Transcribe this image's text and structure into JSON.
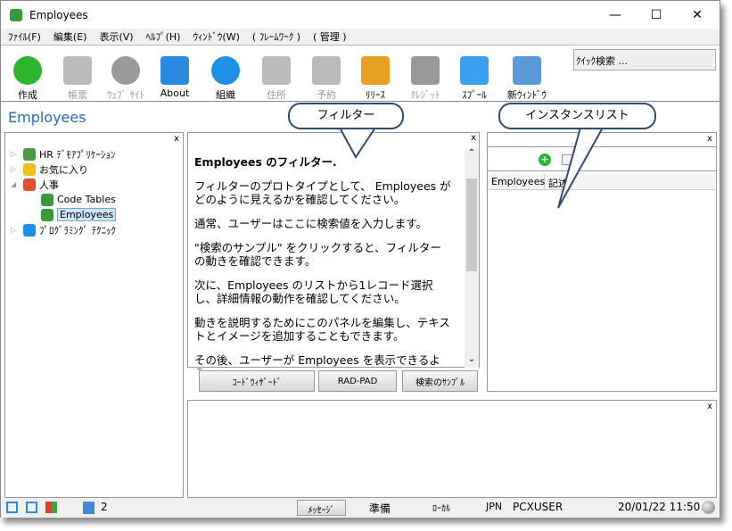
{
  "window": {
    "title": "Employees",
    "minimize": "—",
    "maximize": "☐",
    "close": "✕"
  },
  "menu": [
    "ﾌｧｲﾙ(F)",
    "編集(E)",
    "表示(V)",
    "ﾍﾙﾌﾟ(H)",
    "ｳｨﾝﾄﾞｳ(W)",
    "( ﾌﾚｰﾑﾜｰｸ )",
    "( 管理 )"
  ],
  "toolbar": [
    {
      "label": "作成",
      "icon": "add-icon",
      "color": "#2db52d",
      "enabled": true
    },
    {
      "label": "帳票",
      "icon": "folder-icon",
      "color": "#bbbbbb",
      "enabled": false
    },
    {
      "label": "ｳｪﾌﾞ ｻｲﾄ",
      "icon": "globe-icon",
      "color": "#9a9a9a",
      "enabled": false
    },
    {
      "label": "About",
      "icon": "about-icon",
      "color": "#2a8ae0",
      "enabled": true
    },
    {
      "label": "組織",
      "icon": "gear-icon",
      "color": "#1e90e8",
      "enabled": true
    },
    {
      "label": "住所",
      "icon": "envelope-icon",
      "color": "#bbbbbb",
      "enabled": false
    },
    {
      "label": "予約",
      "icon": "clock-icon",
      "color": "#bbbbbb",
      "enabled": false
    },
    {
      "label": "ﾘﾘｰｽ",
      "icon": "support-person-icon",
      "color": "#e8a020",
      "enabled": true
    },
    {
      "label": "ｸﾚｼﾞｯﾄ",
      "icon": "database-icon",
      "color": "#999999",
      "enabled": false
    },
    {
      "label": "ｽﾌﾟｰﾙ",
      "icon": "document-icon",
      "color": "#3aa0f0",
      "enabled": true
    },
    {
      "label": "新ｳｨﾝﾄﾞｳ",
      "icon": "link-window-icon",
      "color": "#5a9ad8",
      "enabled": true
    }
  ],
  "quick_search": "ｸｲｯｸ検索 ...",
  "page_heading": "Employees",
  "tree": [
    {
      "label": "HR ﾃﾞﾓｱﾌﾟﾘｹｰｼｮﾝ",
      "expander": "▷",
      "level": 0
    },
    {
      "label": "お気に入り",
      "expander": "▷",
      "level": 0
    },
    {
      "label": "人事",
      "expander": "◢",
      "level": 0
    },
    {
      "label": "Code Tables",
      "expander": "",
      "level": 1
    },
    {
      "label": "Employees",
      "expander": "",
      "level": 1,
      "selected": true
    },
    {
      "label": "ﾌﾟﾛｸﾞﾗﾐﾝｸﾞ ﾃｸﾆｯｸ",
      "expander": "▷",
      "level": 0
    }
  ],
  "close_label": "x",
  "filter": {
    "title": "Employees のフィルター.",
    "paragraphs": [
      "フィルターのプロトタイプとして、 Employees がどのように見えるかを確認してください。",
      "通常、ユーザーはここに検索値を入力します。",
      "\"検索のサンプル\" をクリックすると、フィルターの動きを確認できます。",
      "次に、Employees のリストから1レコード選択し、詳細情報の動作を確認してください。",
      "動きを説明するためにこのパネルを編集し、テキストとイメージを追加することもできます。",
      "その後、ユーザーが Employees を表示できるよう、"
    ],
    "buttons": [
      "ｺｰﾄﾞｳｨｻﾞｰﾄﾞ",
      "RAD-PAD",
      "検索のｻﾝﾌﾟﾙ"
    ]
  },
  "instance_list": {
    "columns": [
      "Employees",
      "記述"
    ]
  },
  "callouts": {
    "filter": "フィルター",
    "instance": "インスタンスリスト"
  },
  "status": {
    "count": "2",
    "messages_button": "ﾒｯｾｰｼﾞ",
    "state": "準備",
    "location": "ﾛｰｶﾙ",
    "lang": "JPN",
    "user": "PCXUSER",
    "datetime": "20/01/22 11:50"
  }
}
